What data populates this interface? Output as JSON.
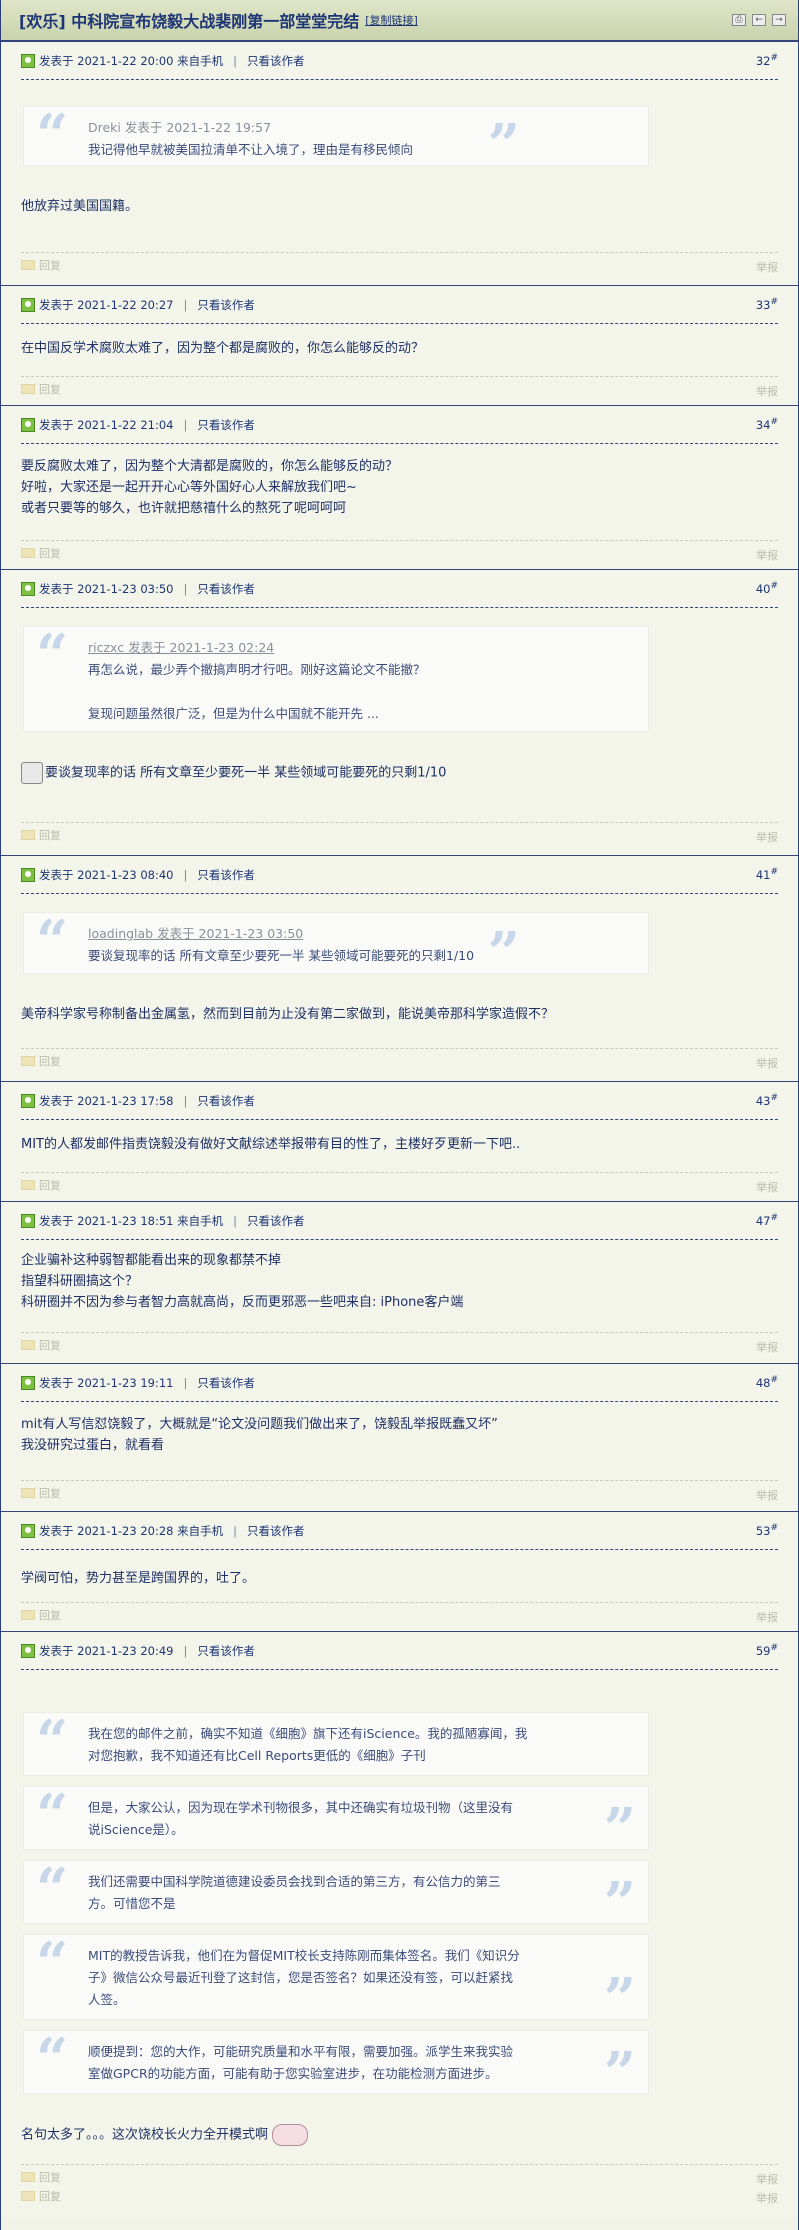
{
  "thread": {
    "title": "[欢乐] 中科院宣布饶毅大战裴刚第一部堂堂完结",
    "copy_link": "[复制链接]"
  },
  "labels": {
    "posted_at_prefix": "发表于",
    "only_author": "只看该作者",
    "reply": "回复",
    "report": "举报",
    "floor_suffix": "#"
  },
  "posts": [
    {
      "time": "2021-1-22 20:00",
      "via": "来自手机",
      "floor": "32",
      "quote": {
        "author": "Dreki 发表于 2021-1-22 19:57",
        "text": "我记得他早就被美国拉清单不让入境了，理由是有移民倾向"
      },
      "body": "他放弃过美国国籍。"
    },
    {
      "time": "2021-1-22 20:27",
      "floor": "33",
      "body": "在中国反学术腐败太难了，因为整个都是腐败的，你怎么能够反的动？"
    },
    {
      "time": "2021-1-22 21:04",
      "floor": "34",
      "body": [
        "要反腐败太难了，因为整个大清都是腐败的，你怎么能够反的动？",
        "好啦，大家还是一起开开心心等外国好心人来解放我们吧~",
        "或者只要等的够久，也许就把慈禧什么的熬死了呢呵呵呵"
      ]
    },
    {
      "time": "2021-1-23 03:50",
      "floor": "40",
      "quote": {
        "author": "riczxc 发表于 2021-1-23 02:24",
        "lines": [
          "再怎么说，最少弄个撤搞声明才行吧。刚好这篇论文不能撤？",
          "",
          "复现问题虽然很广泛，但是为什么中国就不能开先 ..."
        ]
      },
      "body": "要谈复现率的话 所有文章至少要死一半 某些领域可能要死的只剩1/10"
    },
    {
      "time": "2021-1-23 08:40",
      "floor": "41",
      "quote": {
        "author": "loadinglab 发表于 2021-1-23 03:50",
        "text": "要谈复现率的话 所有文章至少要死一半 某些领域可能要死的只剩1/10"
      },
      "body": "美帝科学家号称制备出金属氢，然而到目前为止没有第二家做到，能说美帝那科学家造假不？"
    },
    {
      "time": "2021-1-23 17:58",
      "floor": "43",
      "body": "MIT的人都发邮件指责饶毅没有做好文献综述举报带有目的性了，主楼好歹更新一下吧.."
    },
    {
      "time": "2021-1-23 18:51",
      "via": "来自手机",
      "floor": "47",
      "body": [
        "企业骗补这种弱智都能看出来的现象都禁不掉",
        "指望科研圈搞这个？",
        "科研圈并不因为参与者智力高就高尚，反而更邪恶一些吧来自: iPhone客户端"
      ]
    },
    {
      "time": "2021-1-23 19:11",
      "floor": "48",
      "body": [
        "mit有人写信怼饶毅了，大概就是“论文没问题我们做出来了，饶毅乱举报既蠢又坏”",
        "我没研究过蛋白，就看看"
      ]
    },
    {
      "time": "2021-1-23 20:28",
      "via": "来自手机",
      "floor": "53",
      "body": "学阀可怕，势力甚至是跨国界的，吐了。"
    },
    {
      "time": "2021-1-23 20:49",
      "floor": "59",
      "quotes": [
        [
          "我在您的邮件之前，确实不知道《细胞》旗下还有iScience。我的孤陋寡闻，我",
          "对您抱歉，我不知道还有比Cell Reports更低的《细胞》子刊"
        ],
        [
          "但是，大家公认，因为现在学术刊物很多，其中还确实有垃圾刊物（这里没有",
          "说iScience是）。"
        ],
        [
          "我们还需要中国科学院道德建设委员会找到合适的第三方，有公信力的第三",
          "方。可惜您不是"
        ],
        [
          "MIT的教授告诉我，他们在为督促MIT校长支持陈刚而集体签名。我们《知识分",
          "子》微信公众号最近刊登了这封信，您是否签名？如果还没有签，可以赶紧找",
          "人签。"
        ],
        [
          "顺便提到：您的大作，可能研究质量和水平有限，需要加强。派学生来我实验",
          "室做GPCR的功能方面，可能有助于您实验室进步，在功能检测方面进步。"
        ]
      ],
      "body": "名句太多了。。。这次饶校长火力全开模式啊"
    }
  ],
  "colors": {
    "header_bg": "#d4dcbc",
    "border": "#33457c",
    "post_bg": "#f3f5ea",
    "quote_mark": "#c7d6e8",
    "text": "#1e2f66"
  }
}
